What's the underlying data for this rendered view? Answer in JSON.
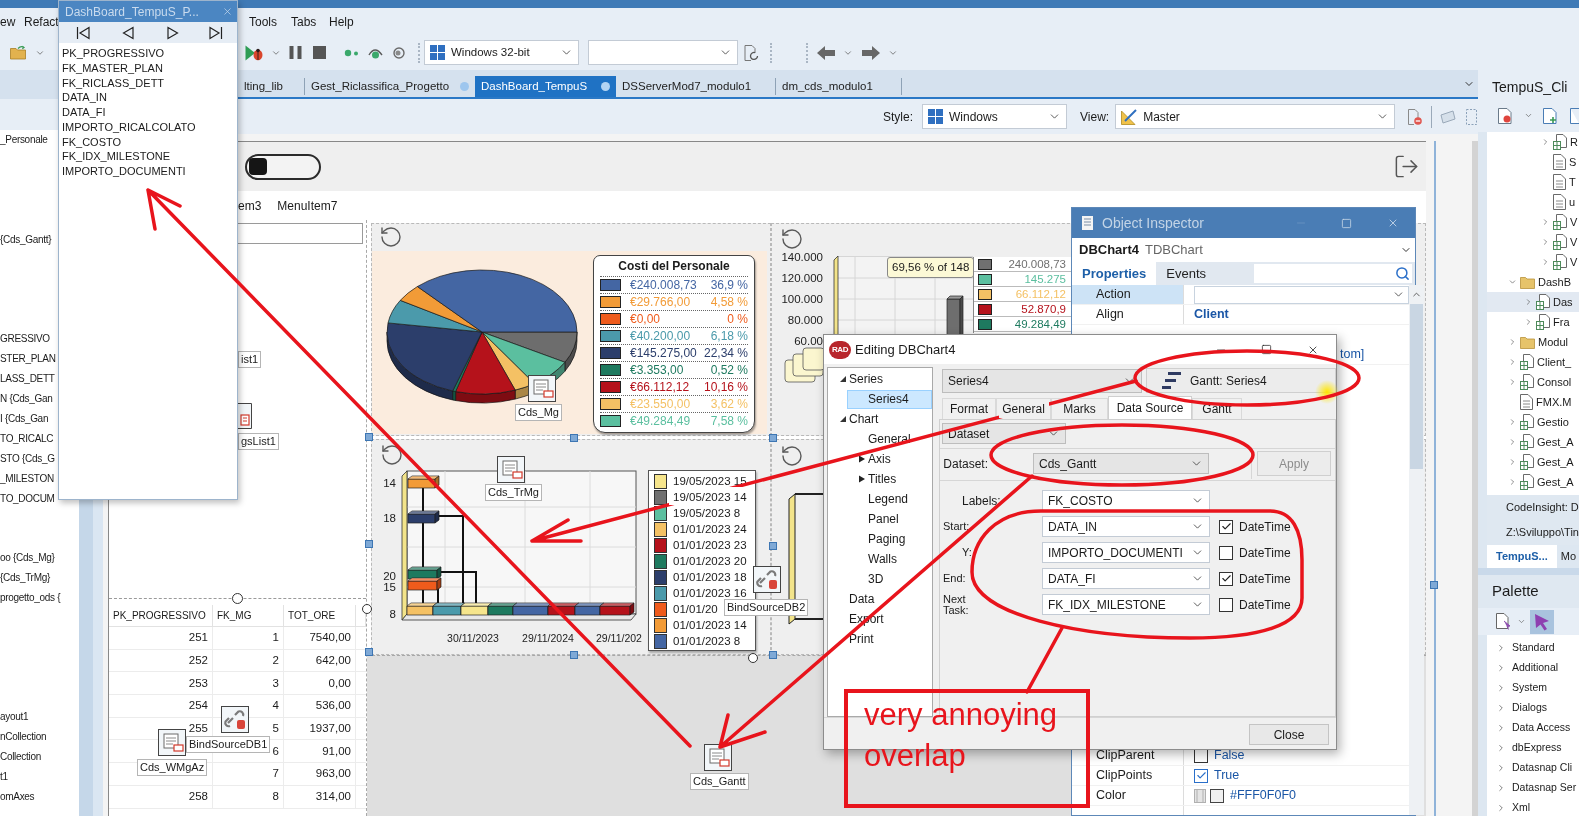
{
  "menu_bar": {
    "items": [
      "ew",
      "Refact",
      "Tools",
      "Tabs",
      "Help"
    ]
  },
  "toolbar": {
    "platform": "Windows 32-bit"
  },
  "editor_tabs": [
    {
      "label": "lting_lib",
      "selected": false,
      "modified": false
    },
    {
      "label": "Gest_Riclassifica_Progetto",
      "selected": false,
      "modified": true
    },
    {
      "label": "DashBoard_TempuS",
      "selected": true,
      "modified": true
    },
    {
      "label": "DSServerMod7_modulo1",
      "selected": false,
      "modified": false
    },
    {
      "label": "dm_cds_modulo1",
      "selected": false,
      "modified": false
    }
  ],
  "designer_bar": {
    "style_label": "Style:",
    "style": "Windows",
    "view_label": "View:",
    "view": "Master"
  },
  "structure_pane": {
    "items": [
      "_Personale",
      "{Cds_Gantt}",
      "GRESSIVO",
      "STER_PLAN",
      "LASS_DETT",
      "N {Cds_Gan",
      "I {Cds_Gan",
      "TO_RICALC",
      "STO {Cds_G",
      "_MILESTON",
      "TO_DOCUM",
      "oo {Cds_Mg}",
      "{Cds_TrMg}",
      "progetto_ods {",
      "ayout1",
      "nCollection",
      "Collection",
      "t1",
      "omAxes"
    ]
  },
  "field_list_window": {
    "title": "DashBoard_TempuS_P...",
    "fields": [
      "PK_PROGRESSIVO",
      "FK_MASTER_PLAN",
      "FK_RICLASS_DETT",
      "DATA_IN",
      "DATA_FI",
      "IMPORTO_RICALCOLATO",
      "FK_COSTO",
      "FK_IDX_MILESTONE",
      "IMPORTO_DOCUMENTI"
    ]
  },
  "form": {
    "switch": {
      "on": false
    },
    "menu": [
      "em3",
      "MenuItem7"
    ],
    "components": [
      {
        "label": "ist1"
      },
      {
        "label": "gsList1",
        "kind": "list"
      },
      {
        "label": "Cds_Mg",
        "kind": "dataset"
      },
      {
        "label": "Cds_TrMg",
        "kind": "dataset"
      },
      {
        "label": "BindSourceDB2",
        "kind": "link"
      },
      {
        "label": "BindSourceDB1",
        "kind": "link"
      },
      {
        "label": "Cds_WMgAz",
        "kind": "dataset"
      },
      {
        "label": "Cds_Gantt",
        "kind": "dataset"
      }
    ],
    "grid": {
      "columns": [
        "PK_PROGRESSIVO",
        "FK_MG",
        "TOT_ORE"
      ],
      "rows": [
        [
          "251",
          "1",
          "7540,00"
        ],
        [
          "252",
          "2",
          "642,00"
        ],
        [
          "253",
          "3",
          "0,00"
        ],
        [
          "254",
          "4",
          "536,00"
        ],
        [
          "255",
          "5",
          "1937,00"
        ],
        [
          null,
          "6",
          "91,00"
        ],
        [
          null,
          "7",
          "963,00"
        ],
        [
          "258",
          "8",
          "314,00"
        ]
      ]
    },
    "pie_chart": {
      "legend_title": "Costi del Personale",
      "legend": [
        {
          "value": "€240.008,73",
          "percent": "36,9 %",
          "color": "#4466a3"
        },
        {
          "value": "€29.766,00",
          "percent": "4,58 %",
          "color": "#f29b37"
        },
        {
          "value": "€0,00",
          "percent": "0 %",
          "color": "#ef5b1c"
        },
        {
          "value": "€40.200,00",
          "percent": "6,18 %",
          "color": "#4b9aab"
        },
        {
          "value": "€145.275,00",
          "percent": "22,34 %",
          "color": "#2c3e6b"
        },
        {
          "value": "€3.353,00",
          "percent": "0,52 %",
          "color": "#1e7a5f"
        },
        {
          "value": "€66.112,12",
          "percent": "10,16 %",
          "color": "#b5121b"
        },
        {
          "value": "€23.550,00",
          "percent": "3,62 %",
          "color": "#f4c164"
        },
        {
          "value": "€49.284,49",
          "percent": "7,58 %",
          "color": "#5bbf9f"
        }
      ]
    },
    "bar_chart": {
      "y_axis_labels": [
        "140.000",
        "120.000",
        "100.000",
        "80.000",
        "60.00"
      ],
      "tooltip": "69,56 % of 148",
      "legend": [
        {
          "value": "240.008,73",
          "color": "#707070"
        },
        {
          "value": "145.275",
          "color": "#5bbf9f"
        },
        {
          "value": "66.112,12",
          "color": "#f4c164"
        },
        {
          "value": "52.870,9",
          "color": "#b5121b"
        },
        {
          "value": "49.284,49",
          "color": "#1e7a5f"
        }
      ]
    },
    "gantt_chart": {
      "y_axis_labels": [
        "14",
        "18",
        "20",
        "15",
        "8"
      ],
      "x_axis_labels": [
        "30/11/2023",
        "29/11/2024",
        "29/11/202"
      ],
      "legend": [
        {
          "label": "19/05/2023 15",
          "color": "#f6e58c"
        },
        {
          "label": "19/05/2023 14",
          "color": "#707070"
        },
        {
          "label": "19/05/2023 8",
          "color": "#5bbf9f"
        },
        {
          "label": "01/01/2023 24",
          "color": "#f4c164"
        },
        {
          "label": "01/01/2023 23",
          "color": "#b5121b"
        },
        {
          "label": "01/01/2023 20",
          "color": "#1e7a5f"
        },
        {
          "label": "01/01/2023 18",
          "color": "#2c3e6b"
        },
        {
          "label": "01/01/2023 16",
          "color": "#4b9aab"
        },
        {
          "label": "01/01/20",
          "color": "#ef5b1c"
        },
        {
          "label": "01/01/2023 14",
          "color": "#f29b37"
        },
        {
          "label": "01/01/2023 8",
          "color": "#4466a3"
        }
      ]
    }
  },
  "object_inspector": {
    "title": "Object Inspector",
    "object_name": "DBChart4",
    "object_type": "TDBChart",
    "tabs": [
      {
        "label": "Properties",
        "selected": true
      },
      {
        "label": "Events",
        "selected": false
      }
    ],
    "top_rows": [
      {
        "name": "Action",
        "kind": "dropdown",
        "selected": true
      },
      {
        "name": "Align",
        "kind": "text",
        "value": "Client",
        "modified": true,
        "selected": false
      },
      {
        "kind": "text",
        "value": "tom]",
        "modified": false
      }
    ],
    "bottom_rows": [
      {
        "name": "ClipParent",
        "kind": "bool",
        "checked": false,
        "value": "False",
        "modified": false,
        "selected": false
      },
      {
        "name": "ClipPoints",
        "kind": "bool",
        "checked": true,
        "value": "True",
        "modified": false,
        "selected": false
      },
      {
        "name": "Color",
        "kind": "color",
        "color": "#f0f0f0",
        "value": "#FFF0F0F0",
        "modified": false,
        "selected": false
      }
    ]
  },
  "chart_editor": {
    "title": "Editing DBChart4",
    "logo_text": "RAD",
    "tree": [
      {
        "label": "Series",
        "expanded": true,
        "selected": false,
        "children": [
          {
            "label": "Series4",
            "selected": true
          }
        ]
      },
      {
        "label": "Chart",
        "expanded": true,
        "selected": false,
        "children": [
          {
            "label": "General",
            "selected": false
          },
          {
            "label": "Axis",
            "expanded": false,
            "selected": false
          },
          {
            "label": "Titles",
            "expanded": false,
            "selected": false
          },
          {
            "label": "Legend",
            "selected": false
          },
          {
            "label": "Panel",
            "selected": false
          },
          {
            "label": "Paging",
            "selected": false
          },
          {
            "label": "Walls",
            "selected": false
          },
          {
            "label": "3D",
            "selected": false
          }
        ]
      },
      {
        "label": "Data",
        "selected": false
      },
      {
        "label": "Export",
        "selected": false
      },
      {
        "label": "Print",
        "selected": false
      }
    ],
    "series": "Series4",
    "series_button": "Gantt: Series4",
    "tabs": [
      {
        "label": "Format",
        "selected": false
      },
      {
        "label": "General",
        "selected": false
      },
      {
        "label": "Marks",
        "selected": false
      },
      {
        "label": "Data Source",
        "selected": true
      },
      {
        "label": "Gantt",
        "selected": false
      }
    ],
    "source": "Dataset",
    "dataset_label": "Dataset:",
    "dataset": "Cds_Gantt",
    "apply": {
      "label": "Apply",
      "disabled": true
    },
    "labels_label": "Labels:",
    "labels_field": "FK_COSTO",
    "fields": [
      {
        "label": "Start:",
        "value": "DATA_IN",
        "datetime": true,
        "datetime_label": "DateTime"
      },
      {
        "label": "Y:",
        "value": "IMPORTO_DOCUMENTI",
        "datetime": false,
        "datetime_label": "DateTime"
      },
      {
        "label": "End:",
        "value": "DATA_FI",
        "datetime": true,
        "datetime_label": "DateTime"
      },
      {
        "label": "Next Task:",
        "value": "FK_IDX_MILESTONE",
        "datetime": false,
        "datetime_label": "DateTime"
      }
    ],
    "close": "Close"
  },
  "project_manager": {
    "title": "TempuS_Cli",
    "branch_tail": [
      {
        "text": "R",
        "kind": "unit",
        "expanded": false,
        "selected": false
      },
      {
        "text": "S",
        "kind": "file",
        "selected": false
      },
      {
        "text": "T",
        "kind": "file",
        "selected": false
      },
      {
        "text": "u",
        "kind": "file",
        "selected": false
      },
      {
        "text": "V",
        "kind": "unit",
        "expanded": false,
        "selected": false
      },
      {
        "text": "V",
        "kind": "unit",
        "expanded": false,
        "selected": false
      },
      {
        "text": "V",
        "kind": "unit",
        "expanded": false,
        "selected": false
      }
    ],
    "tree": [
      {
        "text": "DashB",
        "kind": "folder",
        "expanded": true,
        "selected": false,
        "children": [
          {
            "text": "Das",
            "kind": "unit",
            "expanded": false,
            "selected": true
          },
          {
            "text": "Fra",
            "kind": "unit",
            "expanded": false,
            "selected": false
          }
        ]
      },
      {
        "text": "Modul",
        "kind": "folder",
        "expanded": false,
        "selected": false
      },
      {
        "text": "Client_",
        "kind": "unit",
        "expanded": false,
        "selected": false
      },
      {
        "text": "Consol",
        "kind": "unit",
        "expanded": false,
        "selected": false
      },
      {
        "text": "FMX.M",
        "kind": "file",
        "selected": false
      },
      {
        "text": "Gestio",
        "kind": "unit",
        "expanded": false,
        "selected": false
      },
      {
        "text": "Gest_A",
        "kind": "unit",
        "expanded": false,
        "selected": false
      },
      {
        "text": "Gest_A",
        "kind": "unit",
        "expanded": false,
        "selected": false
      },
      {
        "text": "Gest_A",
        "kind": "unit",
        "expanded": false,
        "selected": false
      }
    ],
    "code_insight": "CodeInsight: D",
    "path": "Z:\\Sviluppo\\Tin",
    "tabs": [
      {
        "label": "TempuS...",
        "selected": true
      },
      {
        "label": "Mo",
        "selected": false
      }
    ]
  },
  "palette": {
    "title": "Palette",
    "tools": [
      {
        "kind": "new_component",
        "selected": false
      },
      {
        "kind": "pointer",
        "selected": true
      }
    ],
    "categories": [
      {
        "label": "Standard",
        "expanded": false
      },
      {
        "label": "Additional",
        "expanded": false
      },
      {
        "label": "System",
        "expanded": false
      },
      {
        "label": "Dialogs",
        "expanded": false
      },
      {
        "label": "Data Access",
        "expanded": false
      },
      {
        "label": "dbExpress",
        "expanded": false
      },
      {
        "label": "Datasnap Cli",
        "expanded": false
      },
      {
        "label": "Datasnap Ser",
        "expanded": false
      },
      {
        "label": "Xml",
        "expanded": false
      }
    ]
  },
  "annotation": {
    "text": "very annoying overlap"
  }
}
